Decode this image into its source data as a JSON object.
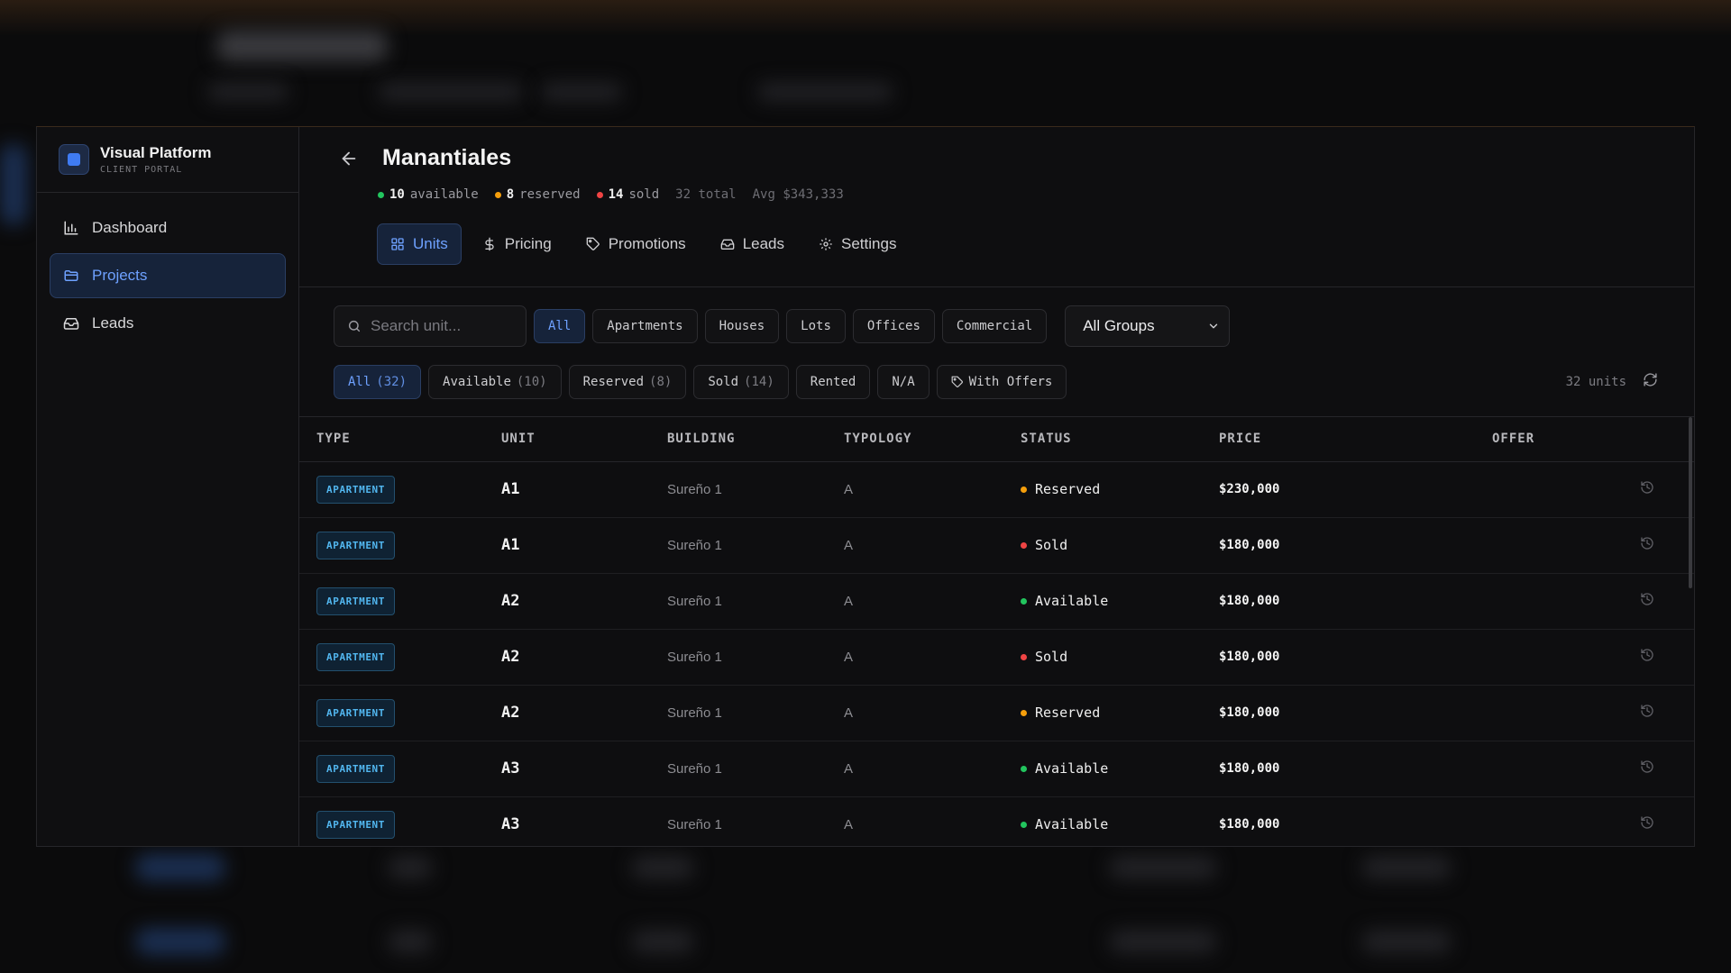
{
  "app": {
    "name": "Visual Platform",
    "subtitle": "CLIENT PORTAL"
  },
  "sidebar": {
    "items": [
      {
        "label": "Dashboard",
        "icon": "bar-chart-icon",
        "active": false
      },
      {
        "label": "Projects",
        "icon": "folder-icon",
        "active": true
      },
      {
        "label": "Leads",
        "icon": "inbox-icon",
        "active": false
      }
    ]
  },
  "project": {
    "title": "Manantiales",
    "stats": {
      "available_count": "10",
      "available_label": "available",
      "reserved_count": "8",
      "reserved_label": "reserved",
      "sold_count": "14",
      "sold_label": "sold",
      "total": "32 total",
      "avg": "Avg $343,333"
    }
  },
  "tabs": [
    {
      "label": "Units",
      "icon": "grid-icon",
      "active": true
    },
    {
      "label": "Pricing",
      "icon": "dollar-icon",
      "active": false
    },
    {
      "label": "Promotions",
      "icon": "tag-icon",
      "active": false
    },
    {
      "label": "Leads",
      "icon": "inbox-icon",
      "active": false
    },
    {
      "label": "Settings",
      "icon": "gear-icon",
      "active": false
    }
  ],
  "toolbar": {
    "search_placeholder": "Search unit...",
    "type_filters": [
      {
        "label": "All",
        "active": true
      },
      {
        "label": "Apartments",
        "active": false
      },
      {
        "label": "Houses",
        "active": false
      },
      {
        "label": "Lots",
        "active": false
      },
      {
        "label": "Offices",
        "active": false
      },
      {
        "label": "Commercial",
        "active": false
      }
    ],
    "group_select": "All Groups"
  },
  "status_filters": [
    {
      "label": "All",
      "count": "(32)",
      "active": true
    },
    {
      "label": "Available",
      "count": "(10)",
      "active": false
    },
    {
      "label": "Reserved",
      "count": "(8)",
      "active": false
    },
    {
      "label": "Sold",
      "count": "(14)",
      "active": false
    },
    {
      "label": "Rented",
      "count": "",
      "active": false
    },
    {
      "label": "N/A",
      "count": "",
      "active": false
    },
    {
      "label": "With Offers",
      "count": "",
      "active": false,
      "icon": "tag-icon"
    }
  ],
  "unit_count": "32 units",
  "colors": {
    "available": "#22c55e",
    "reserved": "#f59e0b",
    "sold": "#ef4444",
    "accent": "#6ea1ff"
  },
  "table": {
    "headers": [
      "TYPE",
      "UNIT",
      "BUILDING",
      "TYPOLOGY",
      "STATUS",
      "PRICE",
      "OFFER"
    ],
    "rows": [
      {
        "type": "APARTMENT",
        "unit": "A1",
        "building": "Sureño 1",
        "typology": "A",
        "status": "Reserved",
        "status_key": "reserved",
        "price": "$230,000"
      },
      {
        "type": "APARTMENT",
        "unit": "A1",
        "building": "Sureño 1",
        "typology": "A",
        "status": "Sold",
        "status_key": "sold",
        "price": "$180,000"
      },
      {
        "type": "APARTMENT",
        "unit": "A2",
        "building": "Sureño 1",
        "typology": "A",
        "status": "Available",
        "status_key": "available",
        "price": "$180,000"
      },
      {
        "type": "APARTMENT",
        "unit": "A2",
        "building": "Sureño 1",
        "typology": "A",
        "status": "Sold",
        "status_key": "sold",
        "price": "$180,000"
      },
      {
        "type": "APARTMENT",
        "unit": "A2",
        "building": "Sureño 1",
        "typology": "A",
        "status": "Reserved",
        "status_key": "reserved",
        "price": "$180,000"
      },
      {
        "type": "APARTMENT",
        "unit": "A3",
        "building": "Sureño 1",
        "typology": "A",
        "status": "Available",
        "status_key": "available",
        "price": "$180,000"
      },
      {
        "type": "APARTMENT",
        "unit": "A3",
        "building": "Sureño 1",
        "typology": "A",
        "status": "Available",
        "status_key": "available",
        "price": "$180,000"
      }
    ]
  }
}
